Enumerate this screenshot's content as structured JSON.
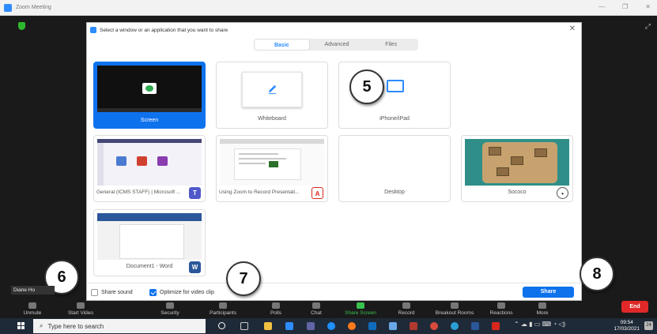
{
  "window": {
    "title": "Zoom Meeting"
  },
  "dialog": {
    "title": "Select a window or an application that you want to share",
    "tabs": [
      {
        "label": "Basic",
        "active": true
      },
      {
        "label": "Advanced",
        "active": false
      },
      {
        "label": "Files",
        "active": false
      }
    ],
    "tiles": [
      {
        "label": "Screen",
        "selected": true
      },
      {
        "label": "Whiteboard"
      },
      {
        "label": "iPhone/iPad"
      },
      {
        "label": "General (ICMS STAFF) | Microsoft ...",
        "badge": "T"
      },
      {
        "label": "Using Zoom to Record Presentati...",
        "badge": "A"
      },
      {
        "label": "Desktop"
      },
      {
        "label": "Sococo",
        "badge": "•"
      },
      {
        "label": "Document1 - Word",
        "badge": "W"
      }
    ],
    "footer": {
      "share_sound": {
        "label": "Share sound",
        "checked": false
      },
      "optimize": {
        "label": "Optimize for video clip",
        "checked": true
      },
      "share_button": "Share"
    }
  },
  "callouts": [
    "5",
    "6",
    "7",
    "8"
  ],
  "participant_name": "Diane Ho",
  "toolbar": {
    "items": [
      "Unmute",
      "Start Video",
      "Security",
      "Participants",
      "Polls",
      "Chat",
      "Share Screen",
      "Record",
      "Breakout Rooms",
      "Reactions",
      "More"
    ],
    "end": "End"
  },
  "taskbar": {
    "search_placeholder": "Type here to search",
    "time": "09:54",
    "date": "17/03/2021",
    "notification_count": "24"
  },
  "colors": {
    "zoom_blue": "#0e72ed",
    "end_red": "#e02828",
    "share_green": "#38c24d",
    "taskbar": "#1f2a38"
  }
}
